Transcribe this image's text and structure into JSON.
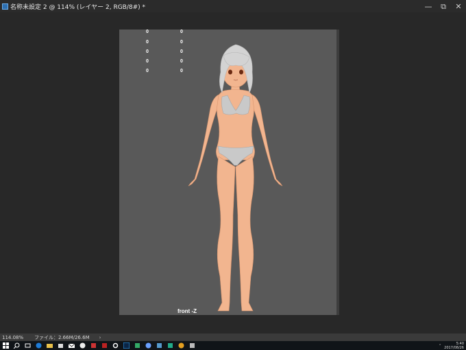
{
  "window": {
    "title": "名称未設定 2 @ 114% (レイヤー 2, RGB/8#) *",
    "controls": {
      "minimize": "—",
      "restore": "⧉",
      "close": "✕"
    }
  },
  "canvas": {
    "readouts": [
      [
        "0",
        "0"
      ],
      [
        "0",
        "0"
      ],
      [
        "0",
        "0"
      ],
      [
        "0",
        "0"
      ],
      [
        "0",
        "0"
      ]
    ],
    "view_label": "front -Z",
    "background_color": "#595959"
  },
  "status": {
    "zoom": "114.08%",
    "file_info": "ファイル：2.66M/26.6M",
    "arrow": "›"
  },
  "taskbar": {
    "icons": [
      "windows-start-icon",
      "search-icon",
      "task-view-icon",
      "edge-icon",
      "explorer-icon",
      "store-icon",
      "mail-icon",
      "app-icon-1",
      "app-icon-2",
      "app-icon-3",
      "settings-icon",
      "photoshop-icon",
      "app-icon-4",
      "app-icon-5",
      "app-icon-6",
      "app-icon-7",
      "app-icon-8",
      "app-icon-9"
    ],
    "clock_time": "5:40",
    "clock_date": "2017/08/26"
  }
}
